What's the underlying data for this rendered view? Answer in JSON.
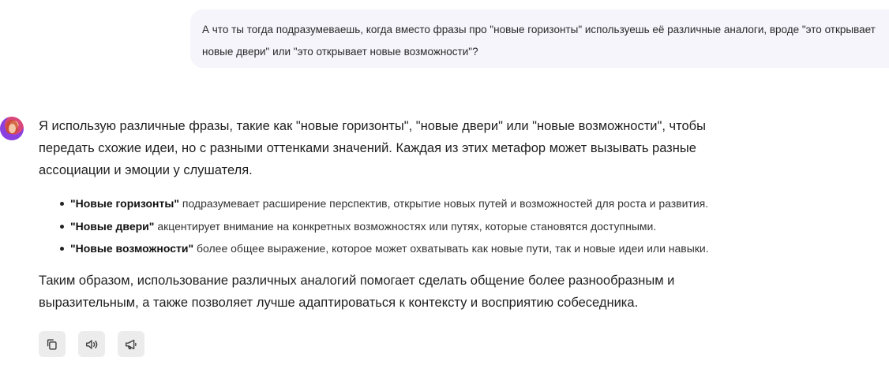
{
  "user_message": {
    "text": "А что ты тогда подразумеваешь, когда вместо фразы про \"новые горизонты\" используешь её различные аналоги, вроде \"это открывает новые двери\" или \"это открывает новые возможности\"?"
  },
  "assistant_message": {
    "intro": "Я использую различные фразы, такие как \"новые горизонты\", \"новые двери\" или \"новые возможности\", чтобы передать схожие идеи, но с разными оттенками значений. Каждая из этих метафор может вызывать разные ассоциации и эмоции у слушателя.",
    "points": [
      {
        "term": "\"Новые горизонты\"",
        "desc": " подразумевает расширение перспектив, открытие новых путей и возможностей для роста и развития."
      },
      {
        "term": "\"Новые двери\"",
        "desc": " акцентирует внимание на конкретных возможностях или путях, которые становятся доступными."
      },
      {
        "term": "\"Новые возможности\"",
        "desc": " более общее выражение, которое может охватывать как новые пути, так и новые идеи или навыки."
      }
    ],
    "conclusion": "Таким образом, использование различных аналогий помогает сделать общение более разнообразным и выразительным, а также позволяет лучше адаптироваться к контексту и восприятию собеседника."
  },
  "actions": [
    {
      "icon": "copy-icon"
    },
    {
      "icon": "speaker-icon"
    },
    {
      "icon": "megaphone-icon"
    }
  ]
}
